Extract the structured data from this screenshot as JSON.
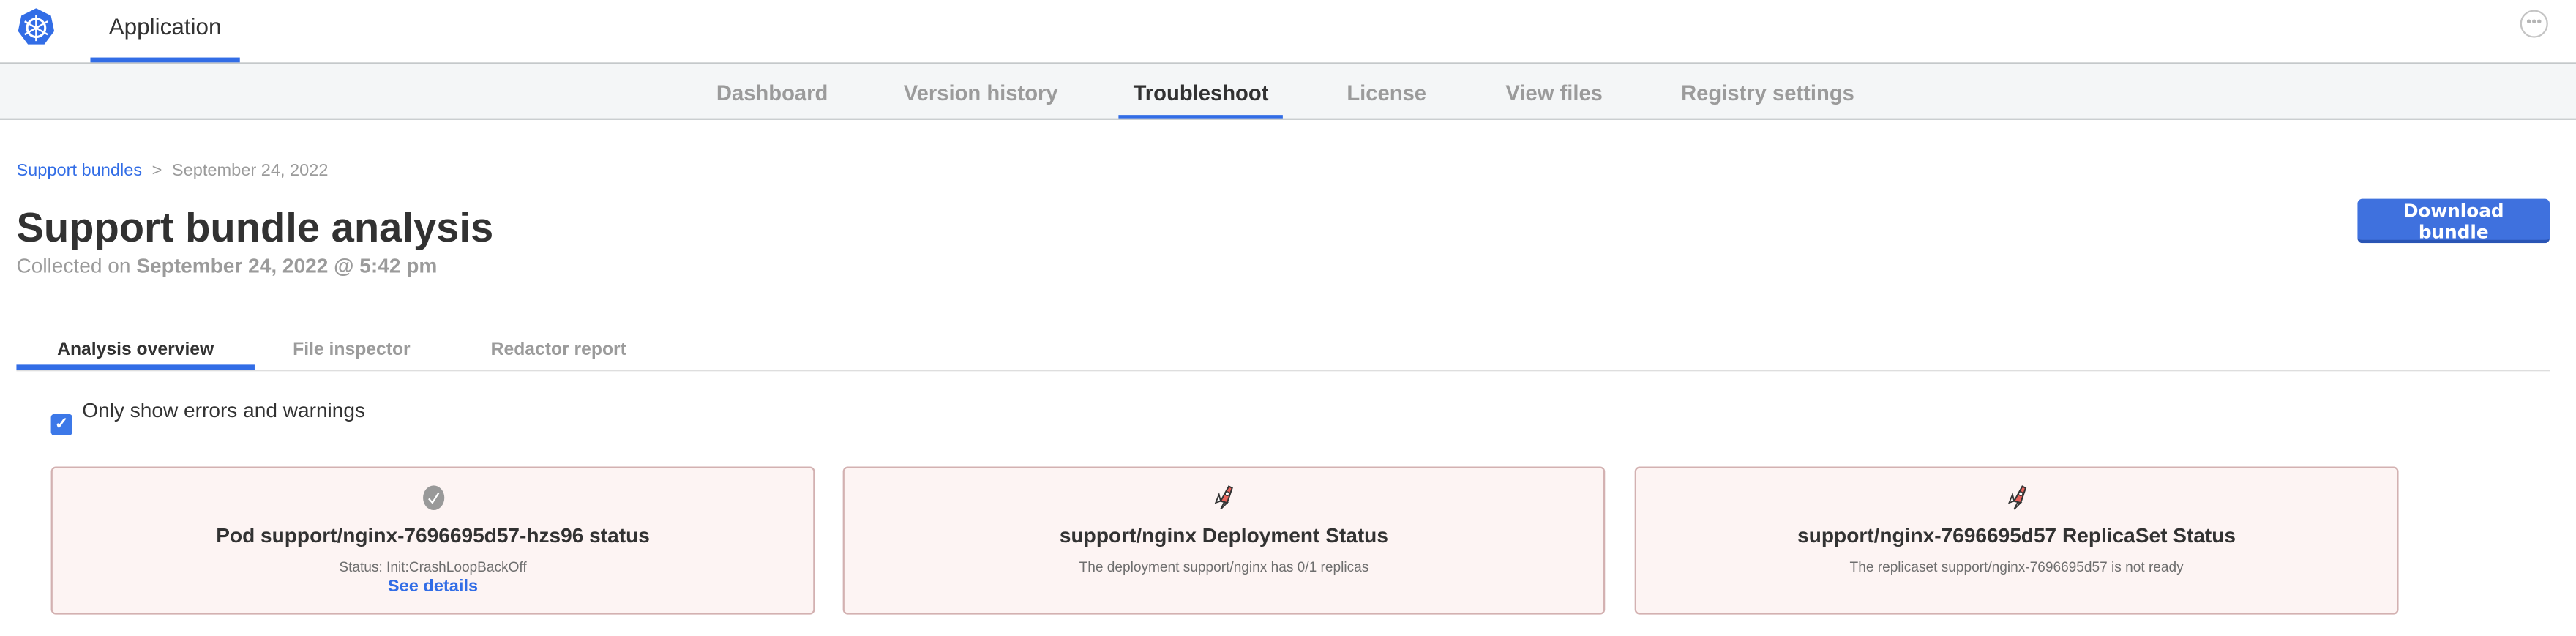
{
  "header": {
    "app_name": "Application",
    "more_icon": "ellipsis-circle-icon"
  },
  "nav": {
    "tabs": [
      {
        "label": "Dashboard"
      },
      {
        "label": "Version history"
      },
      {
        "label": "Troubleshoot",
        "active": true
      },
      {
        "label": "License"
      },
      {
        "label": "View files"
      },
      {
        "label": "Registry settings"
      }
    ]
  },
  "breadcrumb": {
    "parent": "Support bundles",
    "separator": ">",
    "current": "September 24, 2022"
  },
  "page": {
    "title": "Support bundle analysis",
    "collected_prefix": "Collected on",
    "collected_date": "September 24, 2022 @ 5:42 pm",
    "download_label": "Download bundle"
  },
  "subtabs": [
    {
      "label": "Analysis overview",
      "active": true
    },
    {
      "label": "File inspector"
    },
    {
      "label": "Redactor report"
    }
  ],
  "filter": {
    "label": "Only show errors and warnings",
    "checked": true
  },
  "cards": [
    {
      "icon": "check-circle-icon",
      "title": "Pod support/nginx-7696695d57-hzs96 status",
      "message": "Status: Init:CrashLoopBackOff",
      "link": "See details"
    },
    {
      "icon": "rocket-icon",
      "title": "support/nginx Deployment Status",
      "message": "The deployment support/nginx has 0/1 replicas"
    },
    {
      "icon": "rocket-icon",
      "title": "support/nginx-7696695d57 ReplicaSet Status",
      "message": "The replicaset support/nginx-7696695d57 is not ready"
    }
  ],
  "colors": {
    "accent": "#326de6",
    "card_bg": "#fdf4f3",
    "card_border": "#d3b1b1",
    "rocket": "#e8625b"
  }
}
